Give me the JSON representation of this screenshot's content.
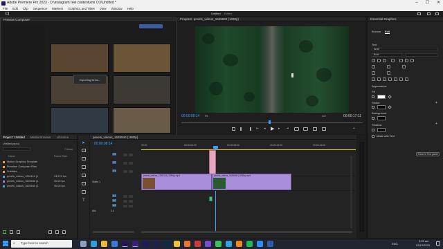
{
  "window": {
    "title": "Adobe Premiere Pro 2023 - D:\\instagram reel content\\xmi CO\\Untitled *",
    "controls": [
      "–",
      "☐",
      "✕"
    ]
  },
  "menu": [
    "File",
    "Edit",
    "Clip",
    "Sequence",
    "Markers",
    "Graphics and Titles",
    "View",
    "Window",
    "Help"
  ],
  "workspace": {
    "tabs": [
      "Untitled",
      "Edited"
    ]
  },
  "preview_dialog": {
    "title": "Preview Composer",
    "status": "Importing Items..."
  },
  "program_monitor": {
    "tab": "Program: pexels_videos_1626940 (1080p)",
    "timecode_current": "00:00:08:14",
    "timecode_total": "00:00:17:11",
    "zoom": "Fit",
    "resolution": "1/2"
  },
  "essential_graphics": {
    "title": "Essential Graphics",
    "tabs": [
      "Browse",
      "Edit"
    ],
    "section_text": "Text",
    "font": "Arial",
    "font_style": "Bold",
    "section_appearance": "Appearance",
    "fill_label": "Fill",
    "stroke_label": "Stroke",
    "background_label": "Background",
    "shadow_label": "Shadow",
    "mask_label": "Mask with Text",
    "show_in_text_panel": "Show in Text panel",
    "colors": {
      "fill": "#ffffff",
      "stroke": "#000000",
      "background": "#000000",
      "shadow": "#000000"
    }
  },
  "project_panel": {
    "tabs": [
      "Project: Untitled",
      "Media Browser",
      "Libraries"
    ],
    "file": "Untitled.prproj",
    "item_count": "7 Items",
    "col_name": "Name",
    "col_fps": "Frame Rate",
    "items": [
      {
        "name": "Motion Graphics Template",
        "fps": "",
        "color": "#e8a33c"
      },
      {
        "name": "Premiere Composer Files",
        "fps": "",
        "color": "#e8a33c"
      },
      {
        "name": "Subtitles",
        "fps": "",
        "color": "#e8a33c"
      },
      {
        "name": "pexels_videos_1260114 (1",
        "fps": "23.976 fps",
        "color": "#4aa8d8"
      },
      {
        "name": "pexels_videos_1626940 (1",
        "fps": "30.00 fps",
        "color": "#9d7fd6"
      },
      {
        "name": "pexels_videos_1626940 (1",
        "fps": "30.00 fps",
        "color": "#4aa8d8"
      }
    ]
  },
  "timeline": {
    "tab": "pexels_videos_1626940 (1080p)",
    "timecode": "00:00:08:14",
    "ruler": [
      "00:00",
      "00:00:04:00",
      "00:00:08:00",
      "00:00:12:00",
      "00:00:16:00"
    ],
    "tracks_video": [
      "V3",
      "V2",
      "V1"
    ],
    "tracks_audio": [
      "A1",
      "A2",
      "A3"
    ],
    "clip_v1a": "pexels_videos_1260114 (1080p).mp4",
    "clip_v1b": "pexels_videos_1626940 (1080p).mp4",
    "track_label_video1": "Video 1",
    "mix": "Mix",
    "mix_value": "0.0"
  },
  "taskbar": {
    "search": "Type here to search",
    "time": "3:25 am",
    "date": "03/10/2023",
    "lang": "ENG"
  }
}
